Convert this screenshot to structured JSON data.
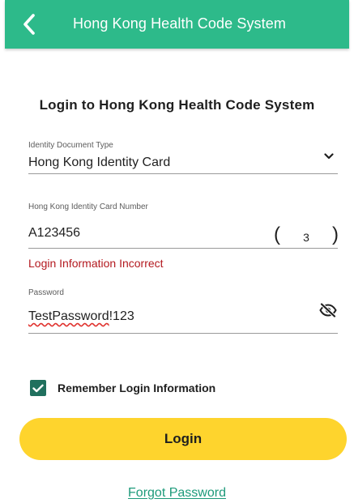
{
  "header": {
    "title": "Hong Kong Health Code System",
    "back_icon": "chevron-left-icon",
    "background": "#2dba8a"
  },
  "form": {
    "title": "Login to Hong Kong Health Code System",
    "doc_type": {
      "label": "Identity Document Type",
      "value": "Hong Kong Identity Card",
      "icon": "chevron-down-icon"
    },
    "id_number": {
      "label": "Hong Kong Identity Card Number",
      "value": "A123456",
      "check_digit_open": "(",
      "check_digit": "3",
      "check_digit_close": ")"
    },
    "error": {
      "text": "Login Information Incorrect",
      "color": "#b3191f"
    },
    "password": {
      "label": "Password",
      "value_misspelled": "TestPassword",
      "value_rest": "!123",
      "icon": "eye-off-icon"
    },
    "remember": {
      "label": "Remember Login Information",
      "checked": true,
      "color": "#20705e"
    },
    "login_button": {
      "label": "Login",
      "color": "#fed42d"
    },
    "forgot_link": {
      "label": "Forgot Password",
      "color": "#1d9a7a"
    }
  }
}
